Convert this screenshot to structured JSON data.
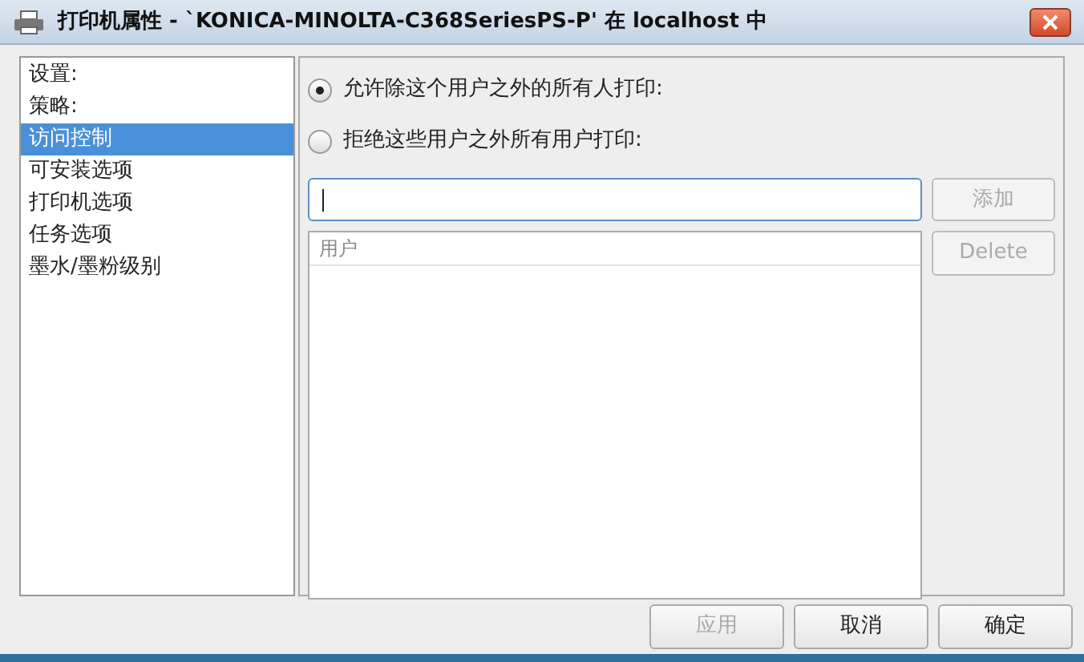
{
  "window": {
    "title": "打印机属性 - `KONICA-MINOLTA-C368SeriesPS-P' 在 localhost 中"
  },
  "sidebar": {
    "items": [
      {
        "label": "设置:",
        "selected": false
      },
      {
        "label": "策略:",
        "selected": false
      },
      {
        "label": "访问控制",
        "selected": true
      },
      {
        "label": "可安装选项",
        "selected": false
      },
      {
        "label": "打印机选项",
        "selected": false
      },
      {
        "label": "任务选项",
        "selected": false
      },
      {
        "label": "墨水/墨粉级别",
        "selected": false
      }
    ]
  },
  "access": {
    "options": [
      {
        "label": "允许除这个用户之外的所有人打印:",
        "selected": true
      },
      {
        "label": "拒绝这些用户之外所有用户打印:",
        "selected": false
      }
    ],
    "user_field": {
      "focused": true
    },
    "add_button": {
      "label": "添加",
      "disabled": true
    },
    "delete_button": {
      "label": "Delete",
      "disabled": true
    },
    "user_list": {
      "columns": [
        "用户"
      ]
    }
  },
  "buttons": [
    {
      "label": "应用",
      "disabled": true
    },
    {
      "label": "取消",
      "disabled": false
    },
    {
      "label": "确定",
      "disabled": false
    }
  ]
}
